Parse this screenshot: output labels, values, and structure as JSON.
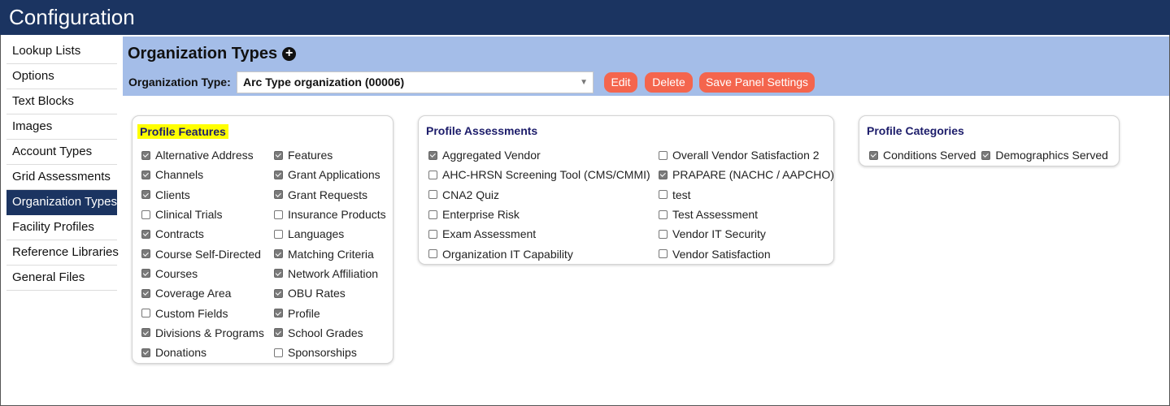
{
  "window": {
    "title": "Configuration"
  },
  "sidebar": {
    "items": [
      {
        "label": "Lookup Lists"
      },
      {
        "label": "Options"
      },
      {
        "label": "Text Blocks"
      },
      {
        "label": "Images"
      },
      {
        "label": "Account Types"
      },
      {
        "label": "Grid Assessments"
      },
      {
        "label": "Organization Types",
        "active": true
      },
      {
        "label": "Facility Profiles"
      },
      {
        "label": "Reference Libraries"
      },
      {
        "label": "General Files"
      }
    ]
  },
  "header": {
    "title": "Organization Types",
    "org_type_label": "Organization Type:",
    "org_type_value": "Arc Type organization (00006)",
    "edit_label": "Edit",
    "delete_label": "Delete",
    "save_label": "Save Panel Settings"
  },
  "profile_features": {
    "title": "Profile Features",
    "col1": [
      {
        "label": "Alternative Address",
        "checked": true
      },
      {
        "label": "Channels",
        "checked": true
      },
      {
        "label": "Clients",
        "checked": true
      },
      {
        "label": "Clinical Trials",
        "checked": false
      },
      {
        "label": "Contracts",
        "checked": true
      },
      {
        "label": "Course Self-Directed",
        "checked": true
      },
      {
        "label": "Courses",
        "checked": true
      },
      {
        "label": "Coverage Area",
        "checked": true
      },
      {
        "label": "Custom Fields",
        "checked": false
      },
      {
        "label": "Divisions & Programs",
        "checked": true
      },
      {
        "label": "Donations",
        "checked": true
      }
    ],
    "col2": [
      {
        "label": "Features",
        "checked": true
      },
      {
        "label": "Grant Applications",
        "checked": true
      },
      {
        "label": "Grant Requests",
        "checked": true
      },
      {
        "label": "Insurance Products",
        "checked": false
      },
      {
        "label": "Languages",
        "checked": false
      },
      {
        "label": "Matching Criteria",
        "checked": true
      },
      {
        "label": "Network Affiliation",
        "checked": true
      },
      {
        "label": "OBU Rates",
        "checked": true
      },
      {
        "label": "Profile",
        "checked": true
      },
      {
        "label": "School Grades",
        "checked": true
      },
      {
        "label": "Sponsorships",
        "checked": false
      }
    ]
  },
  "profile_assessments": {
    "title": "Profile Assessments",
    "col1": [
      {
        "label": "Aggregated Vendor",
        "checked": true
      },
      {
        "label": "AHC-HRSN Screening Tool (CMS/CMMI)",
        "checked": false
      },
      {
        "label": "CNA2 Quiz",
        "checked": false
      },
      {
        "label": "Enterprise Risk",
        "checked": false
      },
      {
        "label": "Exam Assessment",
        "checked": false
      },
      {
        "label": "Organization IT Capability",
        "checked": false
      }
    ],
    "col2": [
      {
        "label": "Overall Vendor Satisfaction 2",
        "checked": false
      },
      {
        "label": "PRAPARE (NACHC / AAPCHO)",
        "checked": true
      },
      {
        "label": "test",
        "checked": false
      },
      {
        "label": "Test Assessment",
        "checked": false
      },
      {
        "label": "Vendor IT Security",
        "checked": false
      },
      {
        "label": "Vendor Satisfaction",
        "checked": false
      }
    ]
  },
  "profile_categories": {
    "title": "Profile Categories",
    "items": [
      {
        "label": "Conditions Served",
        "checked": true
      },
      {
        "label": "Demographics Served",
        "checked": true
      }
    ]
  },
  "colors": {
    "titlebar": "#1b3461",
    "panel": "#a4bde8",
    "button": "#f4654d",
    "highlight": "#ffff00"
  },
  "icons": {
    "add": "plus-circle-icon",
    "dropdown": "chevron-down-icon"
  }
}
